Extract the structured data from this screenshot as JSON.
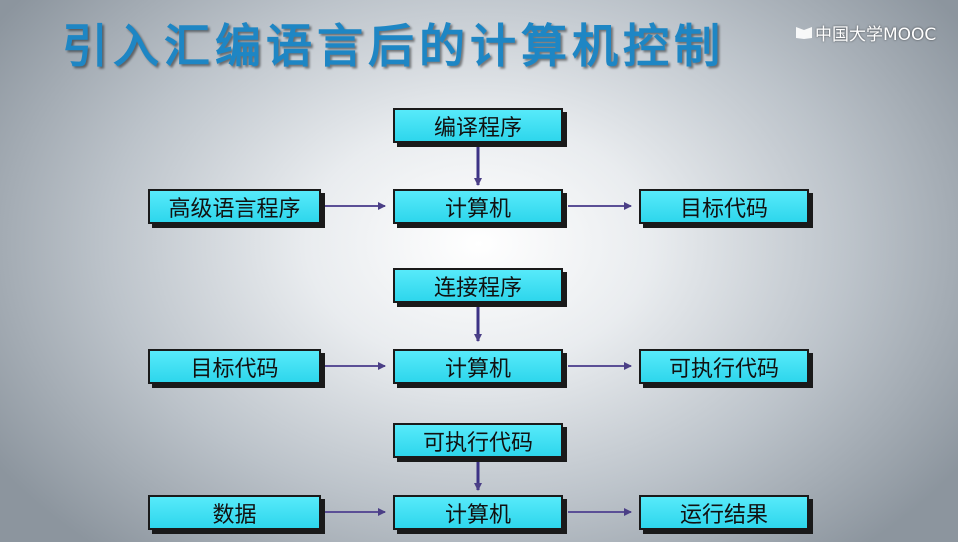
{
  "title": "引入汇编语言后的计算机控制",
  "watermark": "中国大学MOOC",
  "stages": [
    {
      "top": "编译程序",
      "input": "高级语言程序",
      "center": "计算机",
      "output": "目标代码"
    },
    {
      "top": "连接程序",
      "input": "目标代码",
      "center": "计算机",
      "output": "可执行代码"
    },
    {
      "top": "可执行代码",
      "input": "数据",
      "center": "计算机",
      "output": "运行结果"
    }
  ],
  "colors": {
    "box": "#3fe0f2",
    "arrow": "#5b4f96",
    "title": "#1e86c4"
  },
  "icons": {
    "watermark": "mooc-logo-icon"
  }
}
